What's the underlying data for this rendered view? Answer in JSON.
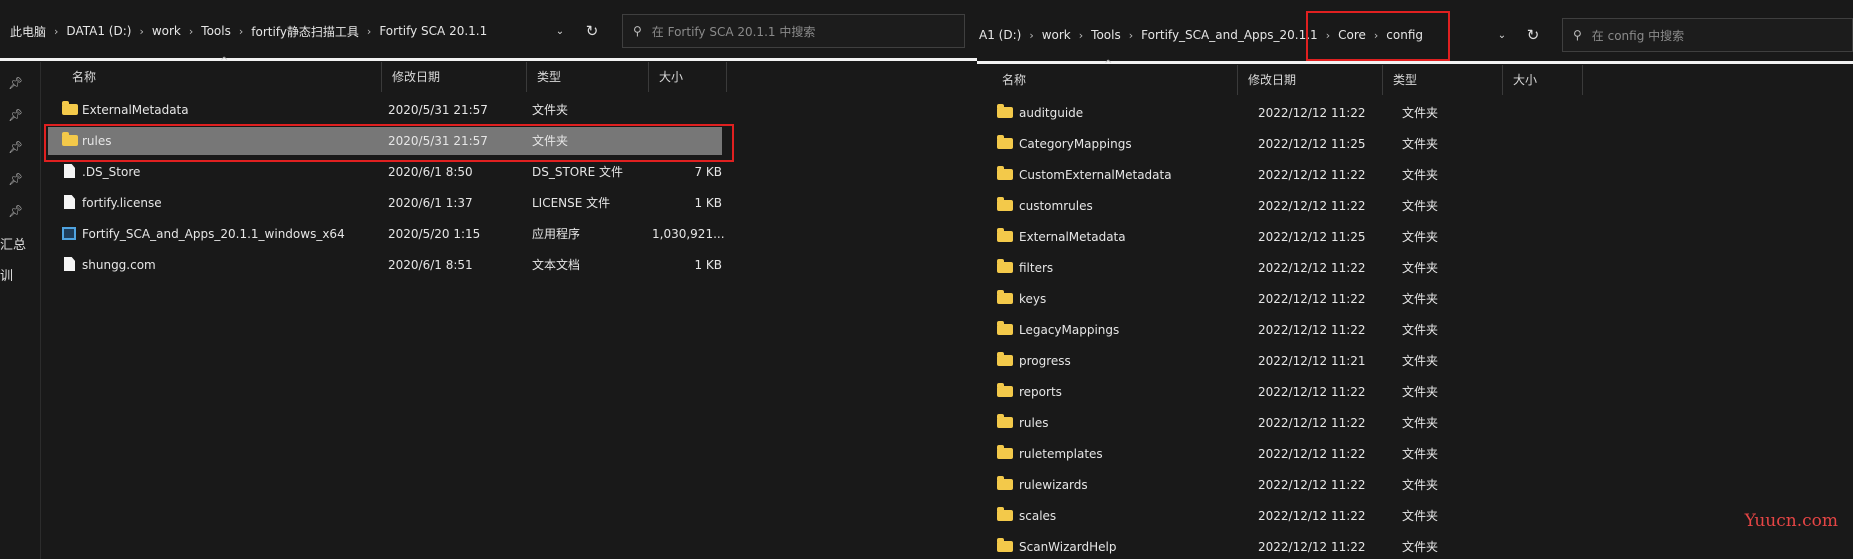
{
  "left": {
    "breadcrumb": [
      "此电脑",
      "DATA1 (D:)",
      "work",
      "Tools",
      "fortify静态扫描工具",
      "Fortify SCA 20.1.1"
    ],
    "search_placeholder": "在 Fortify SCA 20.1.1 中搜索",
    "columns": [
      "名称",
      "修改日期",
      "类型",
      "大小"
    ],
    "files": [
      {
        "name": "ExternalMetadata",
        "date": "2020/5/31 21:57",
        "type": "文件夹",
        "size": "",
        "icon": "folder-icon"
      },
      {
        "name": "rules",
        "date": "2020/5/31 21:57",
        "type": "文件夹",
        "size": "",
        "icon": "folder-icon"
      },
      {
        "name": ".DS_Store",
        "date": "2020/6/1 8:50",
        "type": "DS_STORE 文件",
        "size": "7 KB",
        "icon": "file-icon"
      },
      {
        "name": "fortify.license",
        "date": "2020/6/1 1:37",
        "type": "LICENSE 文件",
        "size": "1 KB",
        "icon": "file-icon"
      },
      {
        "name": "Fortify_SCA_and_Apps_20.1.1_windows_x64",
        "date": "2020/5/20 1:15",
        "type": "应用程序",
        "size": "1,030,921...",
        "icon": "application-icon"
      },
      {
        "name": "shungg.com",
        "date": "2020/6/1 8:51",
        "type": "文本文档",
        "size": "1 KB",
        "icon": "file-icon"
      }
    ],
    "nav_text": [
      "汇总",
      "训"
    ]
  },
  "right": {
    "breadcrumb": [
      "A1 (D:)",
      "work",
      "Tools",
      "Fortify_SCA_and_Apps_20.1.1",
      "Core",
      "config"
    ],
    "search_placeholder": "在 config 中搜索",
    "columns": [
      "名称",
      "修改日期",
      "类型",
      "大小"
    ],
    "files": [
      {
        "name": "auditguide",
        "date": "2022/12/12 11:22",
        "type": "文件夹"
      },
      {
        "name": "CategoryMappings",
        "date": "2022/12/12 11:25",
        "type": "文件夹"
      },
      {
        "name": "CustomExternalMetadata",
        "date": "2022/12/12 11:22",
        "type": "文件夹"
      },
      {
        "name": "customrules",
        "date": "2022/12/12 11:22",
        "type": "文件夹"
      },
      {
        "name": "ExternalMetadata",
        "date": "2022/12/12 11:25",
        "type": "文件夹"
      },
      {
        "name": "filters",
        "date": "2022/12/12 11:22",
        "type": "文件夹"
      },
      {
        "name": "keys",
        "date": "2022/12/12 11:22",
        "type": "文件夹"
      },
      {
        "name": "LegacyMappings",
        "date": "2022/12/12 11:22",
        "type": "文件夹"
      },
      {
        "name": "progress",
        "date": "2022/12/12 11:21",
        "type": "文件夹"
      },
      {
        "name": "reports",
        "date": "2022/12/12 11:22",
        "type": "文件夹"
      },
      {
        "name": "rules",
        "date": "2022/12/12 11:22",
        "type": "文件夹"
      },
      {
        "name": "ruletemplates",
        "date": "2022/12/12 11:22",
        "type": "文件夹"
      },
      {
        "name": "rulewizards",
        "date": "2022/12/12 11:22",
        "type": "文件夹"
      },
      {
        "name": "scales",
        "date": "2022/12/12 11:22",
        "type": "文件夹"
      },
      {
        "name": "ScanWizardHelp",
        "date": "2022/12/12 11:22",
        "type": "文件夹"
      }
    ]
  },
  "watermark": "Yuucn.com",
  "colors": {
    "background": "#191919",
    "selection": "#777777",
    "highlight_box": "#e02020",
    "folder": "#f3c94a"
  }
}
